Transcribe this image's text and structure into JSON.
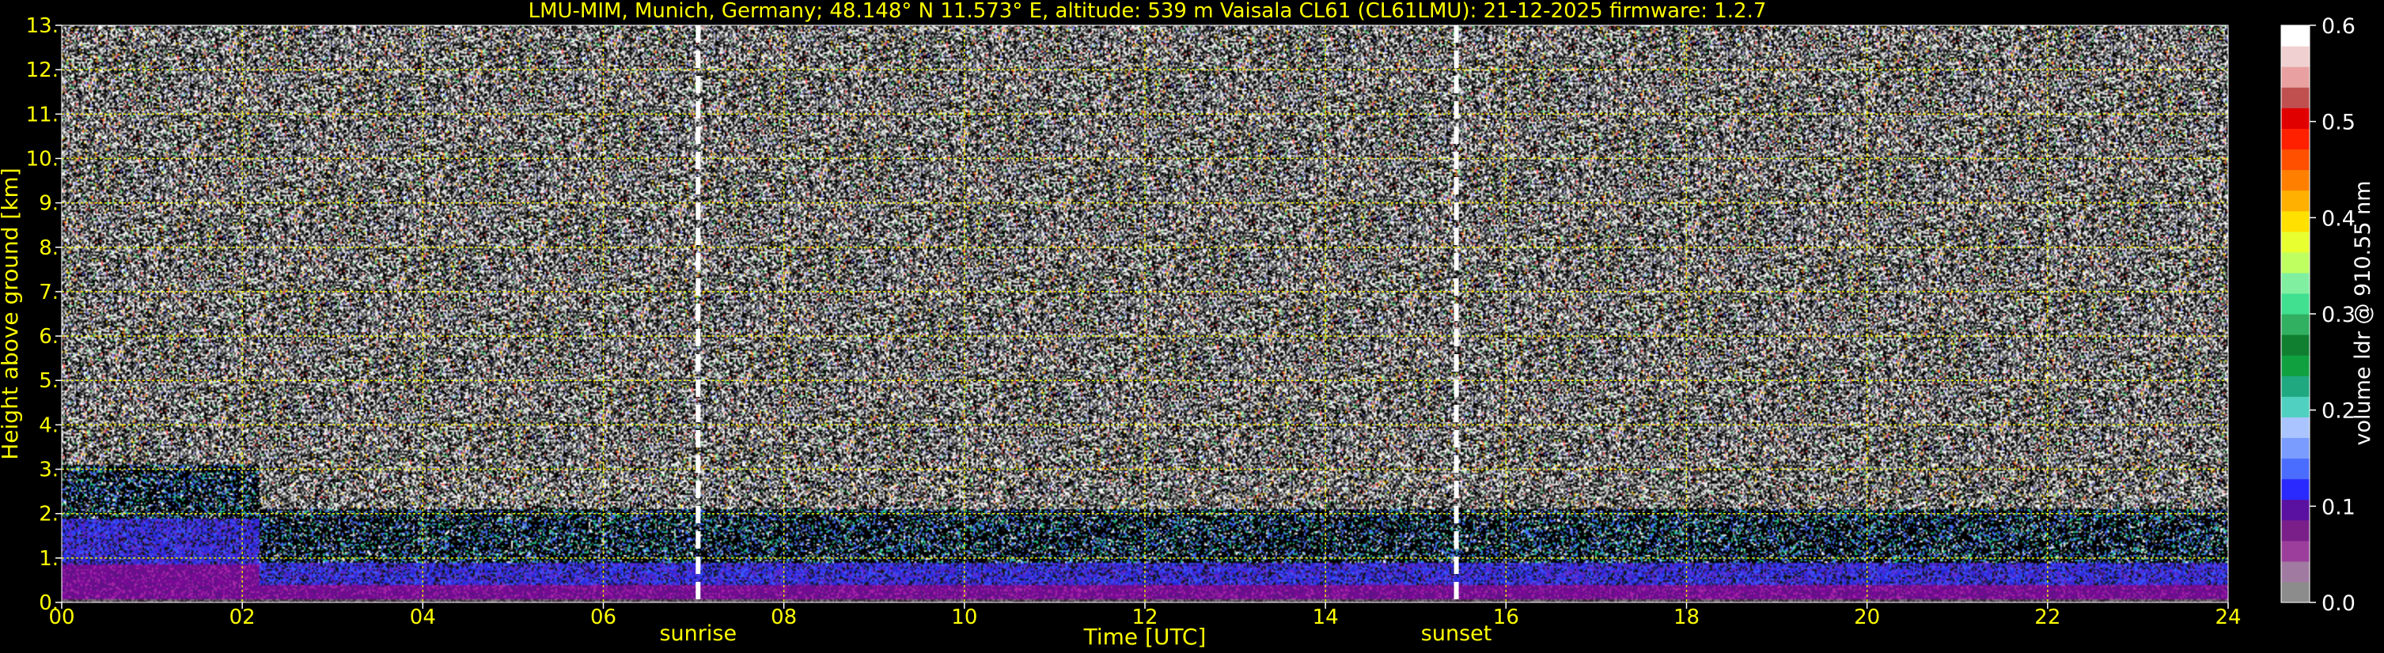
{
  "chart_data": {
    "type": "heatmap",
    "title": "LMU-MIM, Munich, Germany; 48.148° N 11.573° E, altitude: 539 m    Vaisala CL61 (CL61LMU): 21-12-2025    firmware: 1.2.7",
    "xlabel": "Time [UTC]",
    "ylabel": "Height above ground [km]",
    "xlim": [
      0,
      24
    ],
    "ylim": [
      0,
      13
    ],
    "x_ticks": [
      "00",
      "02",
      "04",
      "06",
      "08",
      "10",
      "12",
      "14",
      "16",
      "18",
      "20",
      "22",
      "24"
    ],
    "y_ticks": [
      "0.",
      "1.",
      "2.",
      "3.",
      "4.",
      "5.",
      "6.",
      "7.",
      "8.",
      "9.",
      "10.",
      "11.",
      "12.",
      "13."
    ],
    "grid": true,
    "events": [
      {
        "label": "sunrise",
        "time": 7.05
      },
      {
        "label": "sunset",
        "time": 15.45
      }
    ],
    "colorbar": {
      "label": "volume ldr @ 910.55 nm",
      "range": [
        0.0,
        0.6
      ],
      "ticks": [
        "0.0",
        "0.1",
        "0.2",
        "0.3",
        "0.4",
        "0.5",
        "0.6"
      ],
      "colors": [
        "#8c8c8c",
        "#a07aa0",
        "#9c3f9c",
        "#7a1f8a",
        "#5a10a0",
        "#2a2aff",
        "#4a6cff",
        "#7a9cff",
        "#a9c4ff",
        "#50d0c0",
        "#20a880",
        "#10a040",
        "#108030",
        "#30b060",
        "#40e090",
        "#80f0a0",
        "#c0ff60",
        "#e8ff30",
        "#ffe000",
        "#ffb000",
        "#ff8000",
        "#ff5000",
        "#ff2000",
        "#e00000",
        "#c05050",
        "#e8a0a0",
        "#f0d0d0",
        "#ffffff"
      ]
    },
    "low_layer": [
      {
        "start": 0.0,
        "end": 2.2,
        "top_km": 1.9
      },
      {
        "start": 2.2,
        "end": 24.0,
        "top_km": 0.9
      }
    ]
  }
}
